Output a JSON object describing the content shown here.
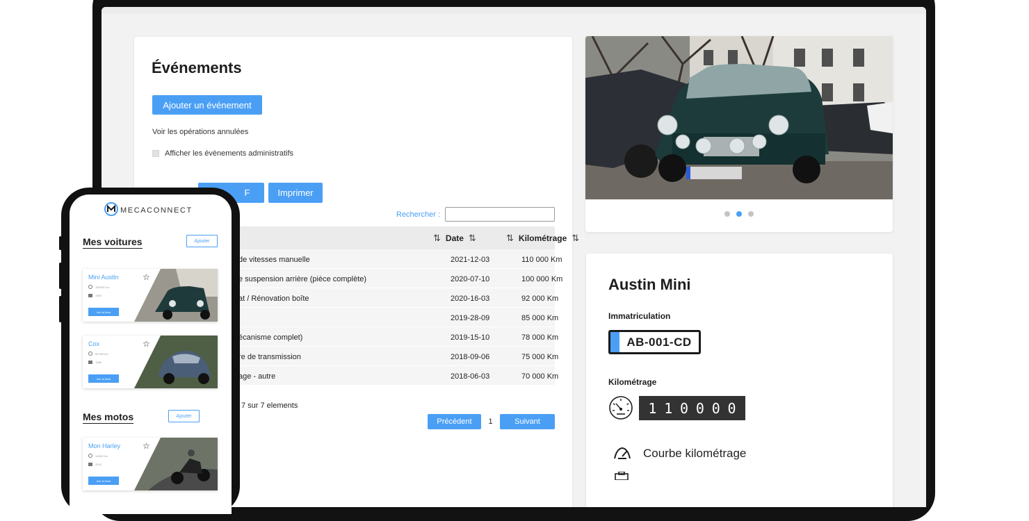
{
  "events": {
    "title": "Événements",
    "add_button": "Ajouter un événement",
    "cancelled_link": "Voir les opérations annulées",
    "admin_checkbox_label": "Afficher les évènements administratifs",
    "pdf_button": "F",
    "print_button": "Imprimer",
    "search_label": "Rechercher :",
    "search_value": "",
    "columns": {
      "date": "Date",
      "mileage": "Kilométrage"
    },
    "rows": [
      {
        "desc": "de vitesses manuelle",
        "date": "2021-12-03",
        "km": "110 000 Km"
      },
      {
        "desc": "e suspension arrière (pièce complète)",
        "date": "2020-07-10",
        "km": "100 000 Km"
      },
      {
        "desc": "at / Rénovation boîte",
        "date": "2020-16-03",
        "km": "92 000 Km"
      },
      {
        "desc": "",
        "date": "2019-28-09",
        "km": "85 000 Km"
      },
      {
        "desc": "écanisme complet)",
        "date": "2019-15-10",
        "km": "78 000 Km"
      },
      {
        "desc": "re de transmission",
        "date": "2018-09-06",
        "km": "75 000 Km"
      },
      {
        "desc": "age - autre",
        "date": "2018-06-03",
        "km": "70 000 Km"
      }
    ],
    "count_text": "7 sur 7 elements",
    "pager": {
      "prev": "Précédent",
      "page": "1",
      "next": "Suivant"
    }
  },
  "carousel": {
    "slides": 3,
    "active": 2
  },
  "vehicle": {
    "name": "Austin Mini",
    "plate_label": "Immatriculation",
    "plate": "AB-001-CD",
    "mileage_label": "Kilométrage",
    "mileage_digits": [
      "1",
      "1",
      "0",
      "0",
      "0",
      "0"
    ],
    "curve_label": "Courbe kilométrage"
  },
  "phone": {
    "brand": "MECACONNECT",
    "cars_title": "Mes voitures",
    "motos_title": "Mes motos",
    "add_label": "Ajouter",
    "cards": [
      {
        "name": "Mini Austin",
        "km": "110000 Km",
        "year": "1990",
        "button": "Voir la fiche"
      },
      {
        "name": "Cox",
        "km": "80 000 km",
        "year": "1986",
        "button": "Voir la fiche"
      },
      {
        "name": "Mon Harley",
        "km": "13000 Km",
        "year": "2016",
        "button": "Voir la fiche"
      }
    ]
  },
  "colors": {
    "accent": "#4a9ff5",
    "dark": "#1d1d1f",
    "odometer": "#333333"
  }
}
